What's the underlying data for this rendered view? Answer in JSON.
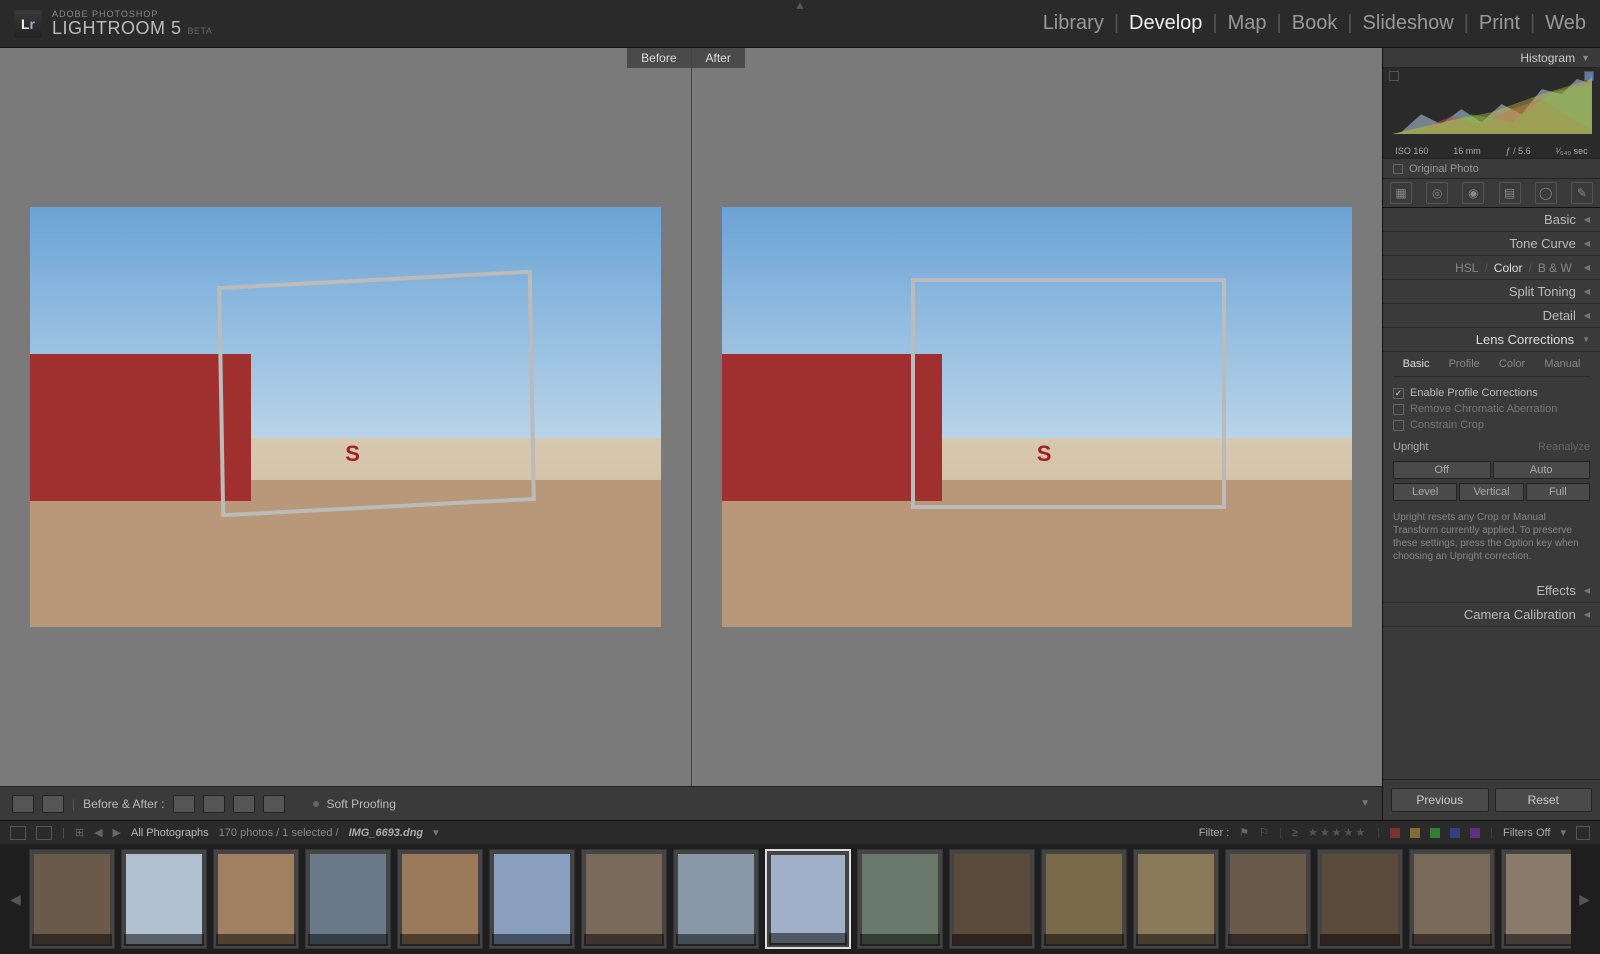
{
  "app": {
    "brand_small": "ADOBE PHOTOSHOP",
    "brand_big": "LIGHTROOM 5",
    "beta": "BETA",
    "logo1": "L",
    "logo2": "r"
  },
  "modules": {
    "items": [
      "Library",
      "Develop",
      "Map",
      "Book",
      "Slideshow",
      "Print",
      "Web"
    ],
    "active": "Develop"
  },
  "compare": {
    "before": "Before",
    "after": "After"
  },
  "sec_toolbar": {
    "before_after": "Before & After :",
    "soft_proofing": "Soft Proofing"
  },
  "right": {
    "histogram_title": "Histogram",
    "meta": {
      "iso": "ISO 160",
      "focal": "16 mm",
      "aperture": "ƒ / 5.6",
      "shutter": "¹⁄₆₄₀ sec"
    },
    "original_photo": "Original Photo",
    "sections": {
      "basic": "Basic",
      "tone_curve": "Tone Curve",
      "hsl": "HSL",
      "color": "Color",
      "bw": "B & W",
      "split_toning": "Split Toning",
      "detail": "Detail",
      "lens_corrections": "Lens Corrections",
      "effects": "Effects",
      "camera_calibration": "Camera Calibration"
    },
    "lens": {
      "tabs": [
        "Basic",
        "Profile",
        "Color",
        "Manual"
      ],
      "enable_profile": "Enable Profile Corrections",
      "remove_ca": "Remove Chromatic Aberration",
      "constrain_crop": "Constrain Crop",
      "upright": "Upright",
      "reanalyze": "Reanalyze",
      "off": "Off",
      "auto": "Auto",
      "level": "Level",
      "vertical": "Vertical",
      "full": "Full",
      "help": "Upright resets any Crop or Manual Transform currently applied. To preserve these settings, press the Option key when choosing an Upright correction."
    },
    "previous": "Previous",
    "reset": "Reset"
  },
  "filmbar": {
    "all_photos": "All Photographs",
    "count": "170 photos / 1 selected /",
    "filename": "IMG_6693.dng",
    "filter_label": "Filter :",
    "filters_off": "Filters Off"
  },
  "filmstrip": {
    "thumbs": [
      {
        "c": "#6a5a4a"
      },
      {
        "c": "#b0c0d0"
      },
      {
        "c": "#a08060"
      },
      {
        "c": "#6a7a8a"
      },
      {
        "c": "#9a7a5a"
      },
      {
        "c": "#8aa0c0"
      },
      {
        "c": "#7a6a5a"
      },
      {
        "c": "#8898a8"
      },
      {
        "c": "#a0b0c8",
        "sel": true
      },
      {
        "c": "#6a7a6a"
      },
      {
        "c": "#5a4a3a"
      },
      {
        "c": "#7a6a4a"
      },
      {
        "c": "#8a7a5a"
      },
      {
        "c": "#6a5a4a"
      },
      {
        "c": "#5a4a3a"
      },
      {
        "c": "#7a6a5a"
      },
      {
        "c": "#8a7a6a"
      },
      {
        "c": "#6a5a4a"
      }
    ]
  }
}
